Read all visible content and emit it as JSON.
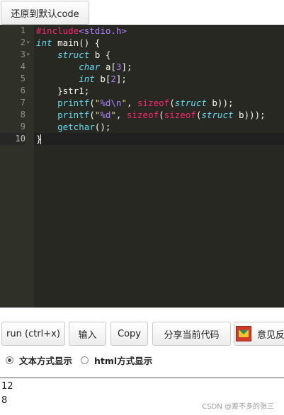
{
  "toolbar_top": {
    "reset_label": "还原到默认code"
  },
  "editor": {
    "line_numbers": [
      "1",
      "2",
      "3",
      "4",
      "5",
      "6",
      "7",
      "8",
      "9",
      "10"
    ],
    "fold_markers": [
      "",
      "▾",
      "▾",
      "",
      "",
      "",
      "",
      "",
      "",
      ""
    ],
    "active_line": 10,
    "lines": [
      [
        {
          "t": "#include",
          "c": "pp"
        },
        {
          "t": "<stdio.h>",
          "c": "inc"
        }
      ],
      [
        {
          "t": "int",
          "c": "kw"
        },
        {
          "t": " main() {",
          "c": ""
        }
      ],
      [
        {
          "t": "    ",
          "c": ""
        },
        {
          "t": "struct",
          "c": "kw"
        },
        {
          "t": " b {",
          "c": ""
        }
      ],
      [
        {
          "t": "        ",
          "c": ""
        },
        {
          "t": "char",
          "c": "kw"
        },
        {
          "t": " a[",
          "c": ""
        },
        {
          "t": "3",
          "c": "num"
        },
        {
          "t": "];",
          "c": ""
        }
      ],
      [
        {
          "t": "        ",
          "c": ""
        },
        {
          "t": "int",
          "c": "kw"
        },
        {
          "t": " b[",
          "c": ""
        },
        {
          "t": "2",
          "c": "num"
        },
        {
          "t": "];",
          "c": ""
        }
      ],
      [
        {
          "t": "    }str1;",
          "c": ""
        }
      ],
      [
        {
          "t": "    ",
          "c": ""
        },
        {
          "t": "printf",
          "c": "fn"
        },
        {
          "t": "(",
          "c": ""
        },
        {
          "t": "\"",
          "c": "str"
        },
        {
          "t": "%d\\n",
          "c": "esc"
        },
        {
          "t": "\"",
          "c": "str"
        },
        {
          "t": ", ",
          "c": ""
        },
        {
          "t": "sizeof",
          "c": "red"
        },
        {
          "t": "(",
          "c": ""
        },
        {
          "t": "struct",
          "c": "kw"
        },
        {
          "t": " b));",
          "c": ""
        }
      ],
      [
        {
          "t": "    ",
          "c": ""
        },
        {
          "t": "printf",
          "c": "fn"
        },
        {
          "t": "(",
          "c": ""
        },
        {
          "t": "\"",
          "c": "str"
        },
        {
          "t": "%d",
          "c": "esc"
        },
        {
          "t": "\"",
          "c": "str"
        },
        {
          "t": ", ",
          "c": ""
        },
        {
          "t": "sizeof",
          "c": "red"
        },
        {
          "t": "(",
          "c": ""
        },
        {
          "t": "sizeof",
          "c": "red"
        },
        {
          "t": "(",
          "c": ""
        },
        {
          "t": "struct",
          "c": "kw"
        },
        {
          "t": " b)));",
          "c": ""
        }
      ],
      [
        {
          "t": "    ",
          "c": ""
        },
        {
          "t": "getchar",
          "c": "fn"
        },
        {
          "t": "();",
          "c": ""
        }
      ],
      [
        {
          "t": "}",
          "c": ""
        }
      ]
    ]
  },
  "actions": {
    "run_label": "run (ctrl+x)",
    "input_label": "输入",
    "copy_label": "Copy",
    "share_label": "分享当前代码",
    "feedback_label": "意见反"
  },
  "display_mode": {
    "text_label": "文本方式显示",
    "html_label": "html方式显示",
    "selected": "text"
  },
  "output": {
    "lines": [
      "12",
      "8"
    ]
  },
  "watermark": "CSDN @差不多的张三"
}
